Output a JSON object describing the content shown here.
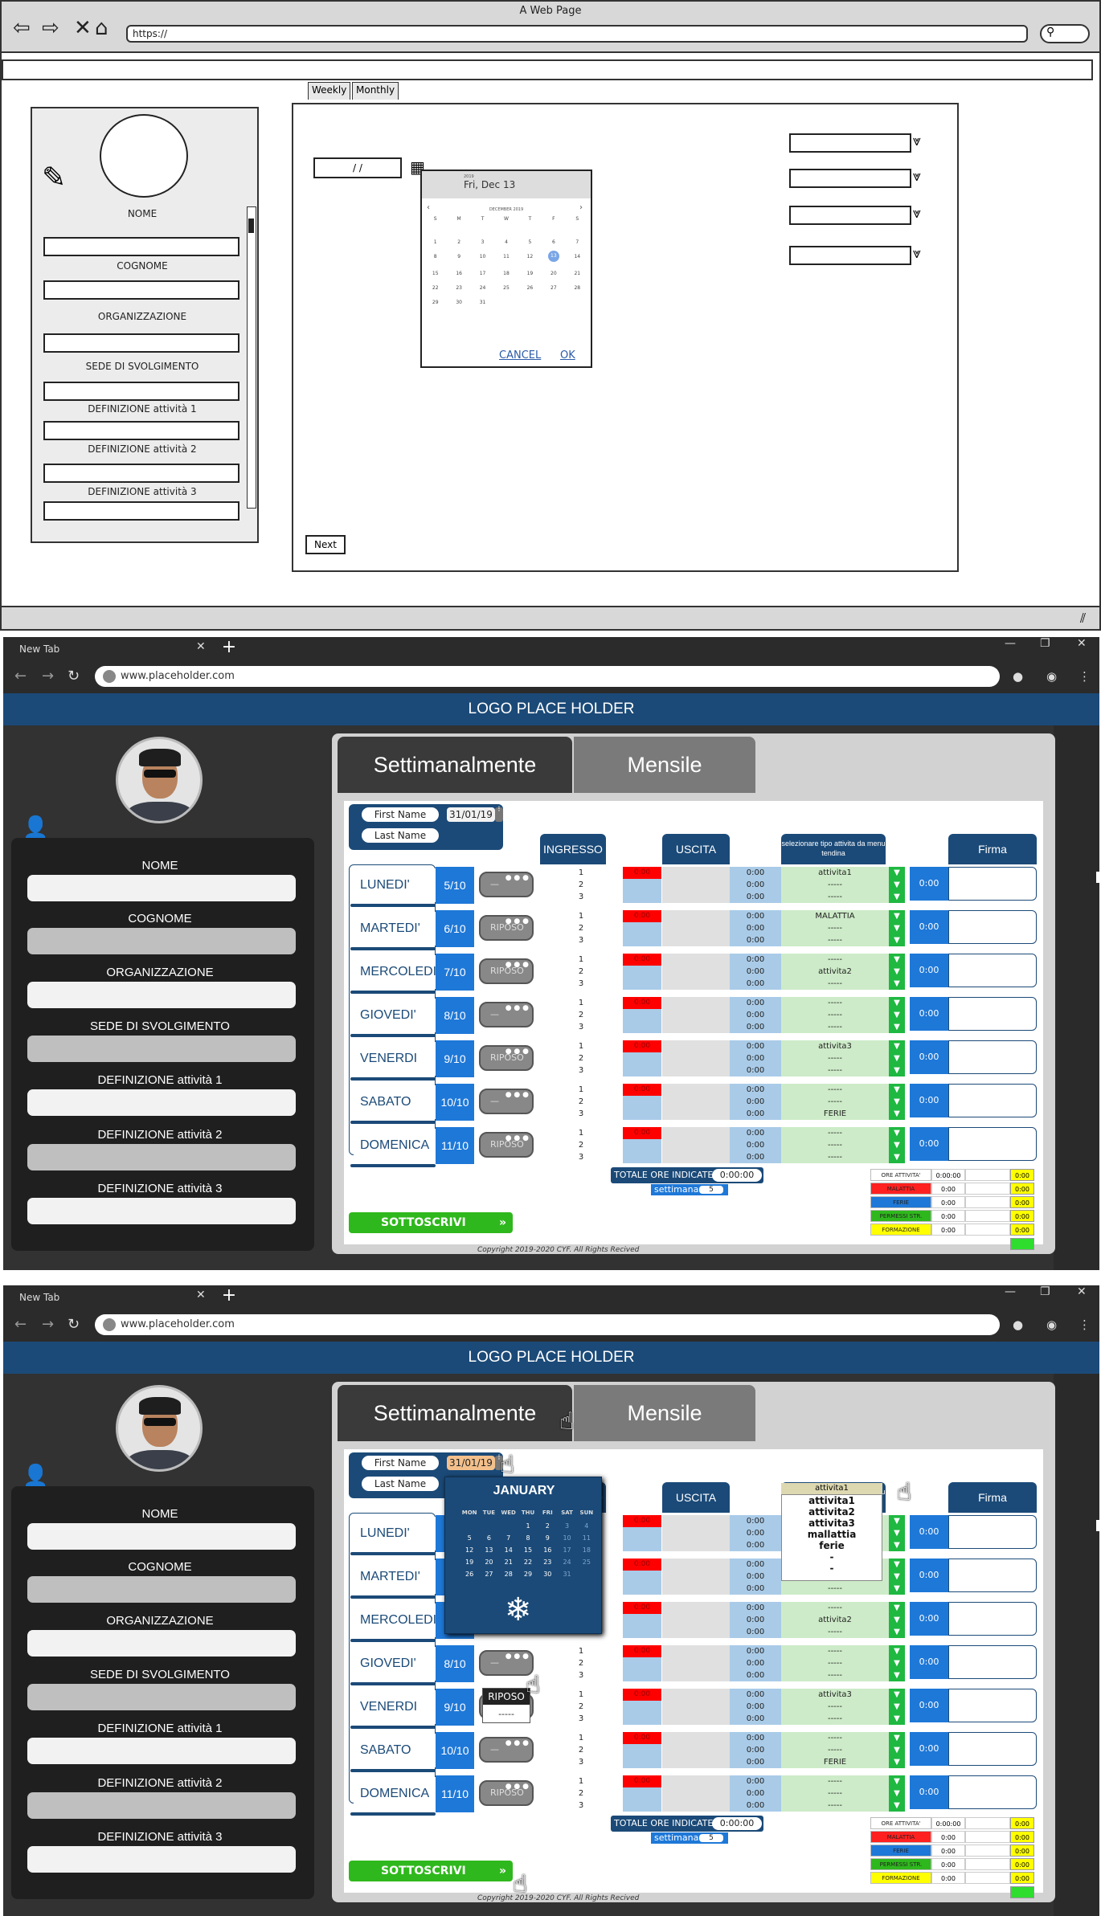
{
  "wireframe": {
    "window_title": "A Web Page",
    "url": "https://",
    "tabs": [
      "Weekly",
      "Monthly"
    ],
    "date_input": "/ /",
    "labels": [
      "NOME",
      "COGNOME",
      "ORGANIZZAZIONE",
      "SEDE DI SVOLGIMENTO",
      "DEFINIZIONE attività 1",
      "DEFINIZIONE attività 2",
      "DEFINIZIONE attività 3"
    ],
    "datepicker": {
      "year": "2019",
      "date": "Fri, Dec 13",
      "month": "DECEMBER 2019",
      "weekdays": [
        "S",
        "M",
        "T",
        "W",
        "T",
        "F",
        "S"
      ],
      "days": [
        "",
        "",
        "",
        "",
        "",
        "",
        "",
        "1",
        "2",
        "3",
        "4",
        "5",
        "6",
        "7",
        "8",
        "9",
        "10",
        "11",
        "12",
        "13",
        "14",
        "15",
        "16",
        "17",
        "18",
        "19",
        "20",
        "21",
        "22",
        "23",
        "24",
        "25",
        "26",
        "27",
        "28",
        "29",
        "30",
        "31"
      ],
      "selected": "13",
      "cancel": "CANCEL",
      "ok": "OK"
    },
    "next": "Next"
  },
  "browser": {
    "tab_title": "New Tab",
    "url": "www.placeholder.com",
    "logo": "LOGO PLACE HOLDER",
    "tabs": [
      "Settimanalmente",
      "Mensile"
    ],
    "left_labels": [
      "NOME",
      "COGNOME",
      "ORGANIZZAZIONE",
      "SEDE DI SVOLGIMENTO",
      "DEFINIZIONE attività 1",
      "DEFINIZIONE attività 2",
      "DEFINIZIONE attività 3"
    ],
    "first_name": "First Name",
    "last_name": "Last Name",
    "date": "31/01/19",
    "headers": {
      "ingresso": "INGRESSO",
      "uscita": "USCITA",
      "select": "selezionare tipo attivita da menu tendina",
      "firma": "Firma"
    },
    "days": [
      {
        "name": "LUNEDI'",
        "date": "5/10",
        "toggle": "—",
        "acts": [
          "attivita1",
          "-----",
          "-----"
        ]
      },
      {
        "name": "MARTEDI'",
        "date": "6/10",
        "toggle": "RIPOSO",
        "acts": [
          "MALATTIA",
          "-----",
          "-----"
        ]
      },
      {
        "name": "MERCOLEDI'",
        "date": "7/10",
        "toggle": "RIPOSO",
        "acts": [
          "-----",
          "attivita2",
          "-----"
        ]
      },
      {
        "name": "GIOVEDI'",
        "date": "8/10",
        "toggle": "—",
        "acts": [
          "-----",
          "-----",
          "-----"
        ]
      },
      {
        "name": "VENERDI",
        "date": "9/10",
        "toggle": "RIPOSO",
        "acts": [
          "attivita3",
          "-----",
          "-----"
        ]
      },
      {
        "name": "SABATO",
        "date": "10/10",
        "toggle": "—",
        "acts": [
          "-----",
          "-----",
          "FERIE"
        ]
      },
      {
        "name": "DOMENICA",
        "date": "11/10",
        "toggle": "RIPOSO",
        "acts": [
          "-----",
          "-----",
          "-----"
        ]
      }
    ],
    "row_nums": [
      "1",
      "2",
      "3"
    ],
    "red_val": "0:00",
    "time_val": "0:00",
    "totale_label": "TOTALE ORE INDICATE",
    "totale_val": "0:00:00",
    "settimana_label": "settimana",
    "settimana_val": "5",
    "sottoscrivi": "SOTTOSCRIVI",
    "copyright": "Copyright 2019-2020 CYF. All Rights Recived",
    "stats": [
      {
        "label": "ORE ATTIVITA'",
        "val": "0:00:00",
        "y": "0:00",
        "color": "#ffffff"
      },
      {
        "label": "MALATTIA",
        "val": "0:00",
        "y": "0:00",
        "color": "#ff2020"
      },
      {
        "label": "FERIE",
        "val": "0:00",
        "y": "0:00",
        "color": "#1e78d8"
      },
      {
        "label": "PERMESSI STR.",
        "val": "0:00",
        "y": "0:00",
        "color": "#2fb81d"
      },
      {
        "label": "FORMAZIONE",
        "val": "0:00",
        "y": "0:00",
        "color": "#ffff00"
      }
    ],
    "calendar": {
      "month": "JANUARY",
      "weekdays": [
        "MON",
        "TUE",
        "WED",
        "THU",
        "FRI",
        "SAT",
        "SUN"
      ],
      "days": [
        "",
        "",
        "",
        "1",
        "2",
        "3",
        "4",
        "5",
        "6",
        "7",
        "8",
        "9",
        "10",
        "11",
        "12",
        "13",
        "14",
        "15",
        "16",
        "17",
        "18",
        "19",
        "20",
        "21",
        "22",
        "23",
        "24",
        "25",
        "26",
        "27",
        "28",
        "29",
        "30",
        "31",
        ""
      ]
    },
    "dropdown_options": [
      "attivita1",
      "attivita2",
      "attivita3",
      "mallattia",
      "ferie",
      "-",
      "-"
    ],
    "riposo_options": [
      "RIPOSO",
      "-----"
    ]
  }
}
